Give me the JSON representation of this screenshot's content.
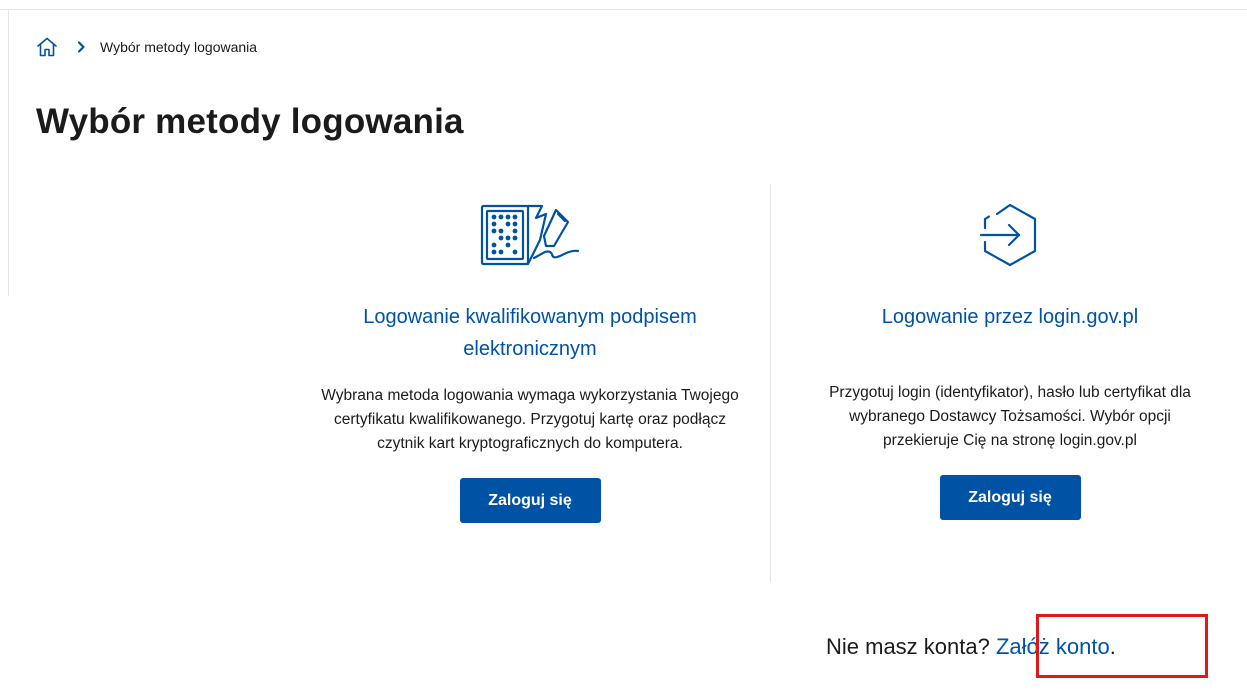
{
  "breadcrumb": {
    "home_icon": "home-icon",
    "separator_icon": "chevron-right-icon",
    "current": "Wybór metody logowania"
  },
  "page": {
    "title": "Wybór metody logowania"
  },
  "methods": [
    {
      "icon": "qualified-signature-icon",
      "title": "Logowanie kwalifikowanym podpisem elektronicznym",
      "description": "Wybrana metoda logowania wymaga wykorzystania Twojego certyfikatu kwalifikowanego. Przygotuj kartę oraz podłącz czytnik kart kryptograficznych do komputera.",
      "button": "Zaloguj się"
    },
    {
      "icon": "login-arrow-icon",
      "title": "Logowanie przez login.gov.pl",
      "description": "Przygotuj login (identyfikator), hasło lub certyfikat dla wybranego Dostawcy Tożsamości. Wybór opcji przekieruje Cię na stronę login.gov.pl",
      "button": "Zaloguj się"
    }
  ],
  "register": {
    "prompt": "Nie masz konta? ",
    "link": "Załóż konto",
    "suffix": "."
  },
  "colors": {
    "primary": "#0052a5",
    "highlight": "#e01818"
  }
}
